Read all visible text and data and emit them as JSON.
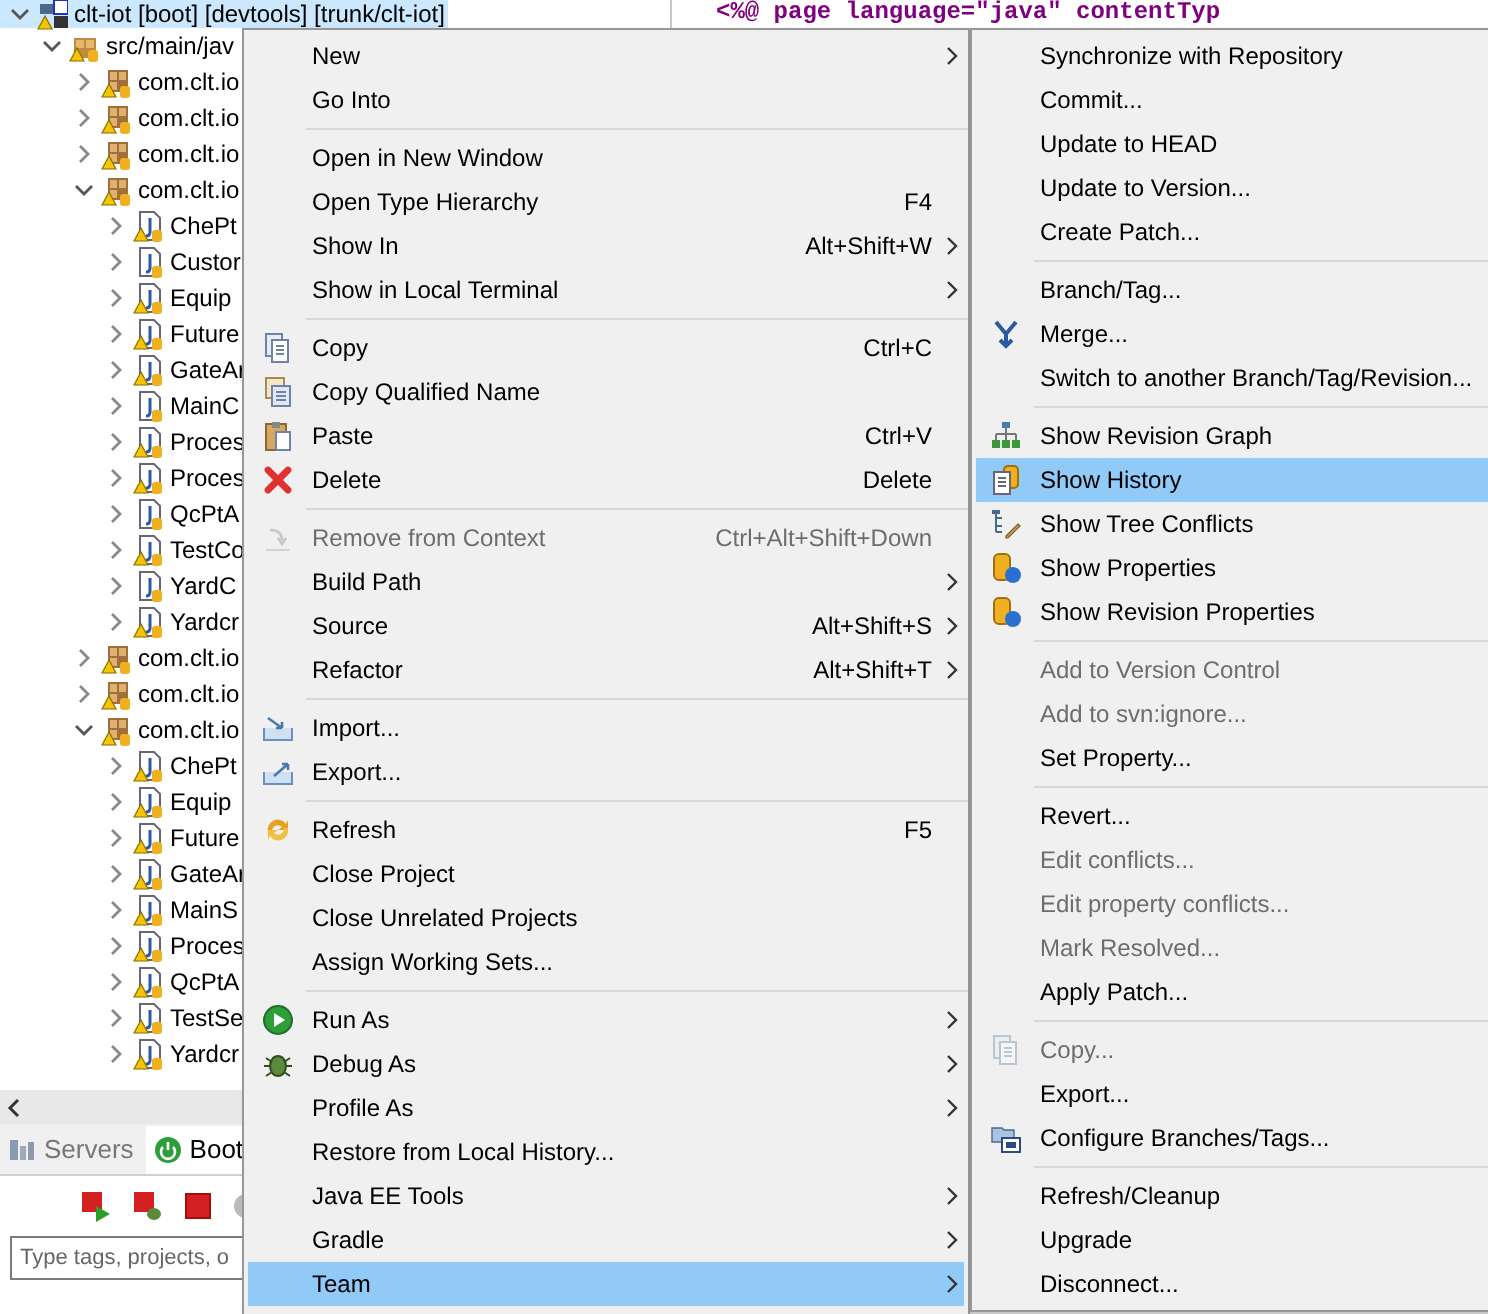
{
  "editor": {
    "code_line": "<%@ page language=\"java\" contentTyp"
  },
  "project_tree": {
    "items": [
      {
        "label": "clt-iot [boot] [devtools] [trunk/clt-iot]",
        "kind": "project",
        "expanded": true,
        "selected": true,
        "warning": true,
        "children": [
          {
            "label": "src/main/jav",
            "kind": "source_folder",
            "expanded": true,
            "selected": false,
            "warning": true,
            "children": [
              {
                "label": "com.clt.io",
                "kind": "package",
                "expanded": false,
                "selected": false,
                "warning": true
              },
              {
                "label": "com.clt.io",
                "kind": "package",
                "expanded": false,
                "selected": false,
                "warning": true
              },
              {
                "label": "com.clt.io",
                "kind": "package",
                "expanded": false,
                "selected": false,
                "warning": true
              },
              {
                "label": "com.clt.io",
                "kind": "package",
                "expanded": true,
                "selected": false,
                "warning": true,
                "children": [
                  {
                    "label": "ChePt",
                    "kind": "class",
                    "expanded": false,
                    "selected": false,
                    "warning": true
                  },
                  {
                    "label": "Custor",
                    "kind": "class",
                    "expanded": false,
                    "selected": false,
                    "warning": false
                  },
                  {
                    "label": "Equip",
                    "kind": "class",
                    "expanded": false,
                    "selected": false,
                    "warning": true
                  },
                  {
                    "label": "Future",
                    "kind": "class",
                    "expanded": false,
                    "selected": false,
                    "warning": true
                  },
                  {
                    "label": "GateAr",
                    "kind": "class",
                    "expanded": false,
                    "selected": false,
                    "warning": true
                  },
                  {
                    "label": "MainC",
                    "kind": "class",
                    "expanded": false,
                    "selected": false,
                    "warning": false
                  },
                  {
                    "label": "Proces",
                    "kind": "class",
                    "expanded": false,
                    "selected": false,
                    "warning": true
                  },
                  {
                    "label": "Proces",
                    "kind": "class",
                    "expanded": false,
                    "selected": false,
                    "warning": true
                  },
                  {
                    "label": "QcPtA",
                    "kind": "class",
                    "expanded": false,
                    "selected": false,
                    "warning": false
                  },
                  {
                    "label": "TestCo",
                    "kind": "class",
                    "expanded": false,
                    "selected": false,
                    "warning": true
                  },
                  {
                    "label": "YardC",
                    "kind": "class",
                    "expanded": false,
                    "selected": false,
                    "warning": false
                  },
                  {
                    "label": "Yardcr",
                    "kind": "class",
                    "expanded": false,
                    "selected": false,
                    "warning": true
                  }
                ]
              },
              {
                "label": "com.clt.io",
                "kind": "package",
                "expanded": false,
                "selected": false,
                "warning": true
              },
              {
                "label": "com.clt.io",
                "kind": "package",
                "expanded": false,
                "selected": false,
                "warning": true
              },
              {
                "label": "com.clt.io",
                "kind": "package",
                "expanded": true,
                "selected": false,
                "warning": true,
                "children": [
                  {
                    "label": "ChePt",
                    "kind": "class",
                    "expanded": false,
                    "selected": false,
                    "warning": true
                  },
                  {
                    "label": "Equip",
                    "kind": "class",
                    "expanded": false,
                    "selected": false,
                    "warning": true
                  },
                  {
                    "label": "Future",
                    "kind": "class",
                    "expanded": false,
                    "selected": false,
                    "warning": true
                  },
                  {
                    "label": "GateAr",
                    "kind": "class",
                    "expanded": false,
                    "selected": false,
                    "warning": true
                  },
                  {
                    "label": "MainS",
                    "kind": "class",
                    "expanded": false,
                    "selected": false,
                    "warning": true
                  },
                  {
                    "label": "Proces",
                    "kind": "class",
                    "expanded": false,
                    "selected": false,
                    "warning": true
                  },
                  {
                    "label": "QcPtA",
                    "kind": "class",
                    "expanded": false,
                    "selected": false,
                    "warning": true
                  },
                  {
                    "label": "TestSe",
                    "kind": "class",
                    "expanded": false,
                    "selected": false,
                    "warning": true
                  },
                  {
                    "label": "Yardcr",
                    "kind": "class",
                    "expanded": false,
                    "selected": false,
                    "warning": true
                  }
                ]
              }
            ]
          }
        ]
      }
    ]
  },
  "bottom_panel": {
    "tabs": [
      {
        "label": "Servers",
        "selected": false
      },
      {
        "label": "Boot",
        "selected": true
      }
    ],
    "filter": {
      "placeholder": "Type tags, projects, o"
    }
  },
  "context_menu": {
    "items": [
      {
        "kind": "item",
        "label": "New",
        "submenu": true,
        "disabled": false,
        "selected": false
      },
      {
        "kind": "item",
        "label": "Go Into",
        "submenu": false,
        "disabled": false,
        "selected": false
      },
      {
        "kind": "separator"
      },
      {
        "kind": "item",
        "label": "Open in New Window",
        "submenu": false,
        "disabled": false,
        "selected": false
      },
      {
        "kind": "item",
        "label": "Open Type Hierarchy",
        "shortcut": "F4",
        "submenu": false,
        "disabled": false,
        "selected": false
      },
      {
        "kind": "item",
        "label": "Show In",
        "shortcut": "Alt+Shift+W",
        "submenu": true,
        "disabled": false,
        "selected": false
      },
      {
        "kind": "item",
        "label": "Show in Local Terminal",
        "submenu": true,
        "disabled": false,
        "selected": false
      },
      {
        "kind": "separator"
      },
      {
        "kind": "item",
        "label": "Copy",
        "shortcut": "Ctrl+C",
        "submenu": false,
        "disabled": false,
        "selected": false
      },
      {
        "kind": "item",
        "label": "Copy Qualified Name",
        "submenu": false,
        "disabled": false,
        "selected": false
      },
      {
        "kind": "item",
        "label": "Paste",
        "shortcut": "Ctrl+V",
        "submenu": false,
        "disabled": false,
        "selected": false
      },
      {
        "kind": "item",
        "label": "Delete",
        "shortcut": "Delete",
        "submenu": false,
        "disabled": false,
        "selected": false
      },
      {
        "kind": "separator"
      },
      {
        "kind": "item",
        "label": "Remove from Context",
        "shortcut": "Ctrl+Alt+Shift+Down",
        "submenu": false,
        "disabled": true,
        "selected": false
      },
      {
        "kind": "item",
        "label": "Build Path",
        "submenu": true,
        "disabled": false,
        "selected": false
      },
      {
        "kind": "item",
        "label": "Source",
        "shortcut": "Alt+Shift+S",
        "submenu": true,
        "disabled": false,
        "selected": false
      },
      {
        "kind": "item",
        "label": "Refactor",
        "shortcut": "Alt+Shift+T",
        "submenu": true,
        "disabled": false,
        "selected": false
      },
      {
        "kind": "separator"
      },
      {
        "kind": "item",
        "label": "Import...",
        "submenu": false,
        "disabled": false,
        "selected": false
      },
      {
        "kind": "item",
        "label": "Export...",
        "submenu": false,
        "disabled": false,
        "selected": false
      },
      {
        "kind": "separator"
      },
      {
        "kind": "item",
        "label": "Refresh",
        "shortcut": "F5",
        "submenu": false,
        "disabled": false,
        "selected": false
      },
      {
        "kind": "item",
        "label": "Close Project",
        "submenu": false,
        "disabled": false,
        "selected": false
      },
      {
        "kind": "item",
        "label": "Close Unrelated Projects",
        "submenu": false,
        "disabled": false,
        "selected": false
      },
      {
        "kind": "item",
        "label": "Assign Working Sets...",
        "submenu": false,
        "disabled": false,
        "selected": false
      },
      {
        "kind": "separator"
      },
      {
        "kind": "item",
        "label": "Run As",
        "submenu": true,
        "disabled": false,
        "selected": false
      },
      {
        "kind": "item",
        "label": "Debug As",
        "submenu": true,
        "disabled": false,
        "selected": false
      },
      {
        "kind": "item",
        "label": "Profile As",
        "submenu": true,
        "disabled": false,
        "selected": false
      },
      {
        "kind": "item",
        "label": "Restore from Local History...",
        "submenu": false,
        "disabled": false,
        "selected": false
      },
      {
        "kind": "item",
        "label": "Java EE Tools",
        "submenu": true,
        "disabled": false,
        "selected": false
      },
      {
        "kind": "item",
        "label": "Gradle",
        "submenu": true,
        "disabled": false,
        "selected": false
      },
      {
        "kind": "item",
        "label": "Team",
        "submenu": true,
        "disabled": false,
        "selected": true
      }
    ]
  },
  "team_submenu": {
    "items": [
      {
        "kind": "item",
        "label": "Synchronize with Repository",
        "disabled": false,
        "selected": false
      },
      {
        "kind": "item",
        "label": "Commit...",
        "disabled": false,
        "selected": false
      },
      {
        "kind": "item",
        "label": "Update to HEAD",
        "disabled": false,
        "selected": false
      },
      {
        "kind": "item",
        "label": "Update to Version...",
        "disabled": false,
        "selected": false
      },
      {
        "kind": "item",
        "label": "Create Patch...",
        "disabled": false,
        "selected": false
      },
      {
        "kind": "separator"
      },
      {
        "kind": "item",
        "label": "Branch/Tag...",
        "disabled": false,
        "selected": false
      },
      {
        "kind": "item",
        "label": "Merge...",
        "disabled": false,
        "selected": false
      },
      {
        "kind": "item",
        "label": "Switch to another Branch/Tag/Revision...",
        "disabled": false,
        "selected": false
      },
      {
        "kind": "separator"
      },
      {
        "kind": "item",
        "label": "Show Revision Graph",
        "disabled": false,
        "selected": false
      },
      {
        "kind": "item",
        "label": "Show History",
        "disabled": false,
        "selected": true
      },
      {
        "kind": "item",
        "label": "Show Tree Conflicts",
        "disabled": false,
        "selected": false
      },
      {
        "kind": "item",
        "label": "Show Properties",
        "disabled": false,
        "selected": false
      },
      {
        "kind": "item",
        "label": "Show Revision Properties",
        "disabled": false,
        "selected": false
      },
      {
        "kind": "separator"
      },
      {
        "kind": "item",
        "label": "Add to Version Control",
        "disabled": true,
        "selected": false
      },
      {
        "kind": "item",
        "label": "Add to svn:ignore...",
        "disabled": true,
        "selected": false
      },
      {
        "kind": "item",
        "label": "Set Property...",
        "disabled": false,
        "selected": false
      },
      {
        "kind": "separator"
      },
      {
        "kind": "item",
        "label": "Revert...",
        "disabled": false,
        "selected": false
      },
      {
        "kind": "item",
        "label": "Edit conflicts...",
        "disabled": true,
        "selected": false
      },
      {
        "kind": "item",
        "label": "Edit property conflicts...",
        "disabled": true,
        "selected": false
      },
      {
        "kind": "item",
        "label": "Mark Resolved...",
        "disabled": true,
        "selected": false
      },
      {
        "kind": "item",
        "label": "Apply Patch...",
        "disabled": false,
        "selected": false
      },
      {
        "kind": "separator"
      },
      {
        "kind": "item",
        "label": "Copy...",
        "disabled": true,
        "selected": false
      },
      {
        "kind": "item",
        "label": "Export...",
        "disabled": false,
        "selected": false
      },
      {
        "kind": "item",
        "label": "Configure Branches/Tags...",
        "disabled": false,
        "selected": false
      },
      {
        "kind": "separator"
      },
      {
        "kind": "item",
        "label": "Refresh/Cleanup",
        "disabled": false,
        "selected": false
      },
      {
        "kind": "item",
        "label": "Upgrade",
        "disabled": false,
        "selected": false
      },
      {
        "kind": "item",
        "label": "Disconnect...",
        "disabled": false,
        "selected": false
      }
    ]
  }
}
